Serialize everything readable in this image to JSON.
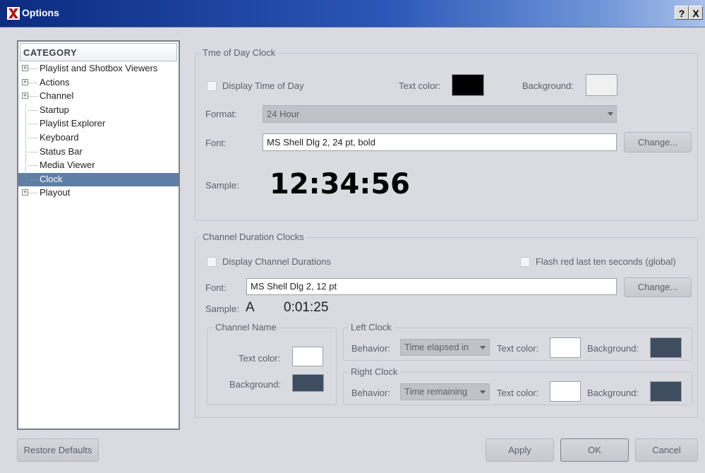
{
  "window": {
    "title": "Options",
    "help_label": "?",
    "close_label": "X"
  },
  "category": {
    "header": "CATEGORY",
    "items": [
      {
        "label": "Playlist and Shotbox Viewers",
        "expandable": true,
        "selected": false
      },
      {
        "label": "Actions",
        "expandable": true,
        "selected": false
      },
      {
        "label": "Channel",
        "expandable": true,
        "selected": false
      },
      {
        "label": "Startup",
        "expandable": false,
        "selected": false
      },
      {
        "label": "Playlist Explorer",
        "expandable": false,
        "selected": false
      },
      {
        "label": "Keyboard",
        "expandable": false,
        "selected": false
      },
      {
        "label": "Status Bar",
        "expandable": false,
        "selected": false
      },
      {
        "label": "Media Viewer",
        "expandable": false,
        "selected": false
      },
      {
        "label": "Clock",
        "expandable": false,
        "selected": true
      },
      {
        "label": "Playout",
        "expandable": true,
        "selected": false
      }
    ]
  },
  "time_of_day": {
    "group_title": "Tme of Day Clock",
    "display_label": "Display Time of Day",
    "display_checked": false,
    "text_color_label": "Text color:",
    "text_color": "#000000",
    "background_label": "Background:",
    "background_color": "#f0f0f0",
    "format_label": "Format:",
    "format_value": "24 Hour",
    "font_label": "Font:",
    "font_value": "MS Shell Dlg 2, 24 pt, bold",
    "change_label": "Change...",
    "sample_label": "Sample:",
    "sample_value": "12:34:56"
  },
  "channel_duration": {
    "group_title": "Channel Duration Clocks",
    "display_label": "Display Channel Durations",
    "display_checked": false,
    "flash_label": "Flash red last ten seconds (global)",
    "flash_checked": false,
    "font_label": "Font:",
    "font_value": "MS Shell Dlg 2, 12 pt",
    "change_label": "Change...",
    "sample_label": "Sample:",
    "sample_letter": "A",
    "sample_time": "0:01:25",
    "channel_name": {
      "title": "Channel Name",
      "text_color_label": "Text color:",
      "text_color": "#ffffff",
      "background_label": "Background:",
      "background_color": "#3f4d60"
    },
    "left_clock": {
      "title": "Left  Clock",
      "behavior_label": "Behavior:",
      "behavior_value": "Time elapsed in",
      "text_color_label": "Text color:",
      "text_color": "#ffffff",
      "background_label": "Background:",
      "background_color": "#3f4d60"
    },
    "right_clock": {
      "title": "Right Clock",
      "behavior_label": "Behavior:",
      "behavior_value": "Time remaining",
      "text_color_label": "Text color:",
      "text_color": "#ffffff",
      "background_label": "Background:",
      "background_color": "#3f4d60"
    }
  },
  "footer": {
    "restore_label": "Restore Defaults",
    "apply_label": "Apply",
    "ok_label": "OK",
    "cancel_label": "Cancel"
  }
}
